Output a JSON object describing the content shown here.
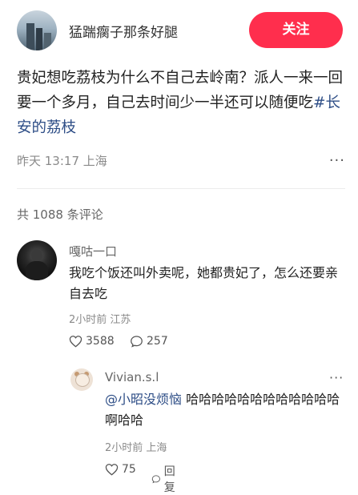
{
  "post": {
    "username": "猛踹瘸子那条好腿",
    "follow_label": "关注",
    "text_main": "贵妃想吃荔枝为什么不自己去岭南？派人一来一回要一个多月，自己去时间少一半还可以随便吃",
    "hashtag": "#长安的荔枝",
    "meta": "昨天 13:17 上海",
    "more_icon": "···"
  },
  "comments_header": {
    "count_text": "共 1088 条评论"
  },
  "comment1": {
    "name": "嘎咕一口",
    "text": "我吃个饭还叫外卖呢，她都贵妃了，怎么还要亲自去吃",
    "meta": "2小时前 江苏",
    "likes": "3588",
    "replies": "257",
    "more_icon": "···"
  },
  "reply1": {
    "name": "Vivian.s.l",
    "mention": "@小昭没烦恼",
    "text": " 哈哈哈哈哈哈哈哈哈哈哈哈啊哈哈",
    "meta": "2小时前 上海",
    "likes": "75",
    "reply_label": "回复",
    "more_icon": "···"
  },
  "colors": {
    "accent": "#ff2e4d",
    "link": "#2d4d86",
    "meta": "#8a8a8a"
  }
}
